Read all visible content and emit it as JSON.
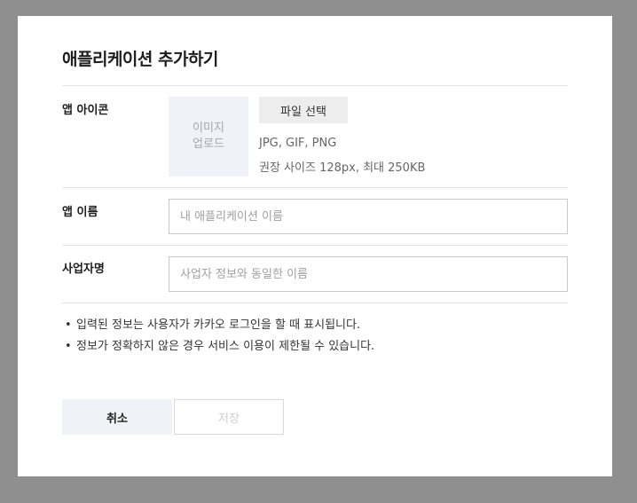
{
  "dialog": {
    "title": "애플리케이션 추가하기"
  },
  "icon_row": {
    "label": "앱 아이콘",
    "upload_line1": "이미지",
    "upload_line2": "업로드",
    "file_button": "파일 선택",
    "formats": "JPG, GIF, PNG",
    "size_hint": "권장 사이즈 128px, 최대 250KB"
  },
  "name_row": {
    "label": "앱 이름",
    "value": "",
    "placeholder": "내 애플리케이션 이름"
  },
  "company_row": {
    "label": "사업자명",
    "value": "",
    "placeholder": "사업자 정보와 동일한 이름"
  },
  "notes": {
    "bullet": "•",
    "items": [
      "입력된 정보는 사용자가 카카오 로그인을 할 때 표시됩니다.",
      "정보가 정확하지 않은 경우 서비스 이용이 제한될 수 있습니다."
    ]
  },
  "actions": {
    "cancel_label": "취소",
    "save_label": "저장",
    "save_enabled": false
  },
  "colors": {
    "overlay": "#8e8f8e",
    "modal_bg": "#ffffff",
    "upload_bg": "#f1f2f7",
    "cancel_bg": "#f1f2f7",
    "file_button_bg": "#ededed",
    "disabled_text": "#cfcfcf"
  }
}
